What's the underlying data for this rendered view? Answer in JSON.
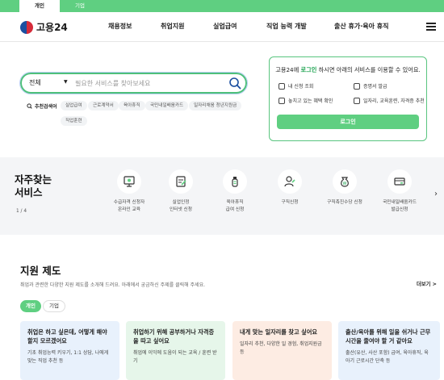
{
  "top_tabs": {
    "personal": "개인",
    "business": "기업"
  },
  "header": {
    "logo_text": "고용24",
    "nav": [
      "채용정보",
      "취업지원",
      "실업급여",
      "직업 능력 개발",
      "출산 휴가·육아 휴직"
    ]
  },
  "search": {
    "scope": "전체",
    "placeholder": "필요한 서비스를 찾아보세요",
    "recommend_label": "추천검색어",
    "chips": [
      "실업급여",
      "근로계약서",
      "육아휴직",
      "국민내일배움카드",
      "일자리채움 청년지원금",
      "직업훈련"
    ]
  },
  "login_box": {
    "title_pre": "고용24에 ",
    "title_highlight": "로그인",
    "title_post": " 하시면 아래의 서비스를 이용할 수 있어요.",
    "items": [
      "내 신청 조회",
      "증명서 발급",
      "놓치고 있는 혜택 확인",
      "일자리, 교육훈련, 자격증 추천"
    ],
    "button": "로그인"
  },
  "frequent_services": {
    "title_line1": "자주찾는",
    "title_line2": "서비스",
    "pager": "1 / 4",
    "items": [
      {
        "line1": "수급자격 신청자",
        "line2": "온라인 교육",
        "icon": "monitor-icon"
      },
      {
        "line1": "실업인정",
        "line2": "인터넷 신청",
        "icon": "document-icon"
      },
      {
        "line1": "육아휴직",
        "line2": "급여 신청",
        "icon": "baby-bottle-icon"
      },
      {
        "line1": "구직신청",
        "line2": "",
        "icon": "person-icon"
      },
      {
        "line1": "구직촉진수당 신청",
        "line2": "",
        "icon": "money-bag-icon"
      },
      {
        "line1": "국민내일배움카드",
        "line2": "발급신청",
        "icon": "card-icon"
      }
    ]
  },
  "support": {
    "title": "지원 제도",
    "desc": "취업과 관련한 다양한 지원 제도를 소개해 드려요. 아래에서 궁금하신 주제를 클릭해 주세요.",
    "more": "더보기 >",
    "seg_on": "개인",
    "seg_off": "기업",
    "cards": [
      {
        "title": "취업은 하고 싶은데, 어떻게 해야 할지 모르겠어요",
        "desc": "기초 취업능력 키우기, 1:1 상담, 나에게 맞는 직업 추천 등",
        "bg": "#e8f1fc"
      },
      {
        "title": "취업하기 위해 공부하거나 자격증을 따고 싶어요",
        "desc": "취업에 이익에 도움이 되는 교육 / 훈련 받기",
        "bg": "#e6f6ea"
      },
      {
        "title": "내게 맞는 일자리를 찾고 싶어요",
        "desc": "일자리 추천, 다양한 일 경험, 취업지원금 등",
        "bg": "#fdece3"
      },
      {
        "title": "출산/육아를 위해 일을 쉬거나 근무 시간을 줄여야 할 거 같아요",
        "desc": "출산(유산, 사산 포함) 급여, 육아휴직, 육아기 근로시간 단축 등",
        "bg": "#e8f1fc"
      }
    ]
  }
}
